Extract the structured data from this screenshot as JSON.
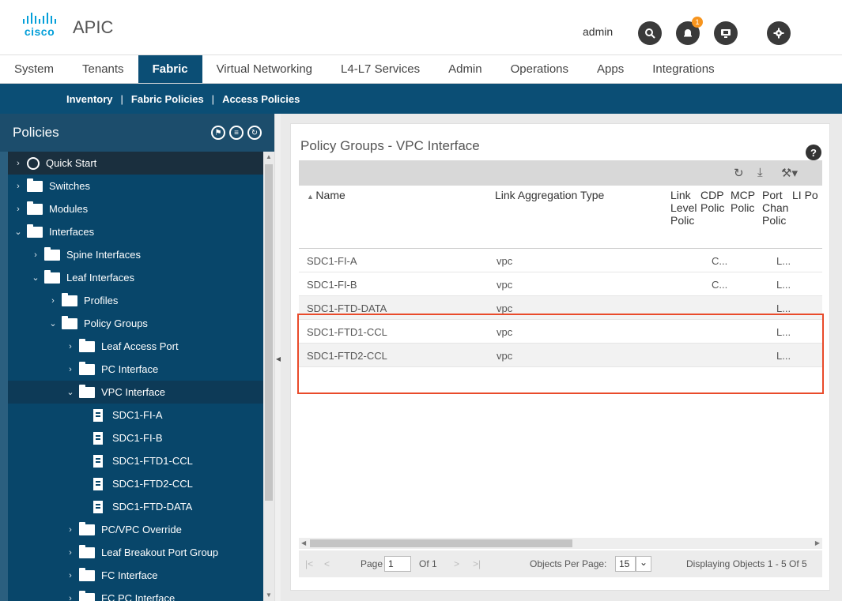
{
  "header": {
    "brand": "cisco",
    "app_title": "APIC",
    "user": "admin",
    "notification_count": "1"
  },
  "topnav": {
    "tabs": [
      "System",
      "Tenants",
      "Fabric",
      "Virtual Networking",
      "L4-L7 Services",
      "Admin",
      "Operations",
      "Apps",
      "Integrations"
    ],
    "active": "Fabric"
  },
  "subnav": {
    "items": [
      "Inventory",
      "Fabric Policies",
      "Access Policies"
    ],
    "active": "Access Policies"
  },
  "sidebar": {
    "title": "Policies",
    "tree": [
      {
        "label": "Quick Start"
      },
      {
        "label": "Switches"
      },
      {
        "label": "Modules"
      },
      {
        "label": "Interfaces"
      },
      {
        "label": "Spine Interfaces"
      },
      {
        "label": "Leaf Interfaces"
      },
      {
        "label": "Profiles"
      },
      {
        "label": "Policy Groups"
      },
      {
        "label": "Leaf Access Port"
      },
      {
        "label": "PC Interface"
      },
      {
        "label": "VPC Interface"
      },
      {
        "label": "SDC1-FI-A"
      },
      {
        "label": "SDC1-FI-B"
      },
      {
        "label": "SDC1-FTD1-CCL"
      },
      {
        "label": "SDC1-FTD2-CCL"
      },
      {
        "label": "SDC1-FTD-DATA"
      },
      {
        "label": "PC/VPC Override"
      },
      {
        "label": "Leaf Breakout Port Group"
      },
      {
        "label": "FC Interface"
      },
      {
        "label": "FC PC Interface"
      }
    ]
  },
  "main": {
    "title": "Policy Groups - VPC Interface",
    "columns": {
      "name": "Name",
      "link_aggregation": "Link Aggregation Type",
      "link_level": "Link Level Polic",
      "cdp": "CDP Polic",
      "mcp": "MCP Polic",
      "port_channel": "Port Chan Polic",
      "lldp": "LI Po"
    },
    "rows": [
      {
        "name": "SDC1-FI-A",
        "type": "vpc",
        "cdp": "C...",
        "port_channel": "L..."
      },
      {
        "name": "SDC1-FI-B",
        "type": "vpc",
        "cdp": "C...",
        "port_channel": "L..."
      },
      {
        "name": "SDC1-FTD-DATA",
        "type": "vpc",
        "cdp": "",
        "port_channel": "L..."
      },
      {
        "name": "SDC1-FTD1-CCL",
        "type": "vpc",
        "cdp": "",
        "port_channel": "L..."
      },
      {
        "name": "SDC1-FTD2-CCL",
        "type": "vpc",
        "cdp": "",
        "port_channel": "L..."
      }
    ],
    "pager": {
      "page_label": "Page",
      "page_value": "1",
      "of_label": "Of 1",
      "per_page_label": "Objects Per Page:",
      "per_page_value": "15",
      "displaying": "Displaying Objects 1 - 5 Of 5"
    }
  },
  "colors": {
    "nav_active": "#0b4e75",
    "sidebar": "#08466a",
    "highlight": "#e94a2a",
    "brand": "#049fd9"
  }
}
